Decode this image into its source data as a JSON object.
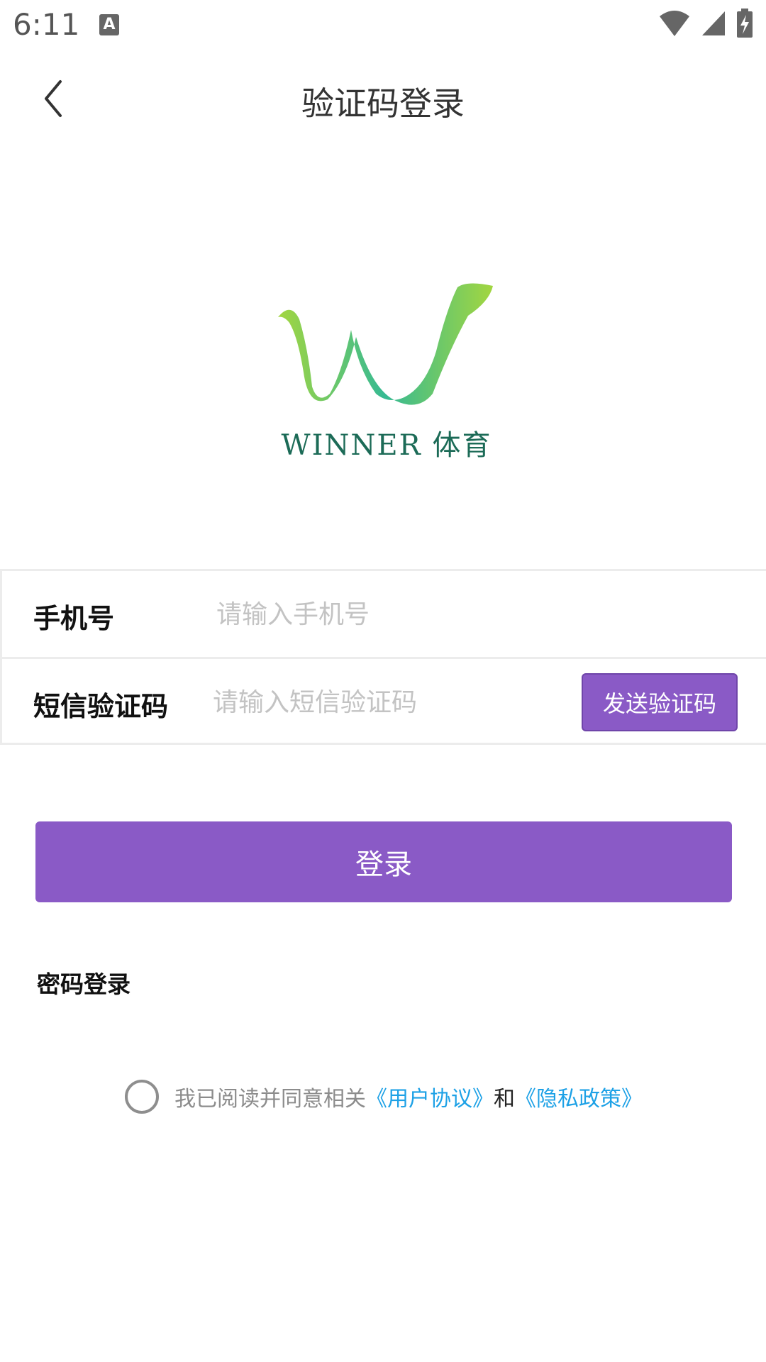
{
  "status_bar": {
    "time": "6:11",
    "notification_icon_letter": "A"
  },
  "header": {
    "title": "验证码登录"
  },
  "logo": {
    "brand_text": "WINNER 体育",
    "colors": [
      "#1c6b57",
      "#9ed436"
    ]
  },
  "form": {
    "phone": {
      "label": "手机号",
      "placeholder": "请输入手机号",
      "value": ""
    },
    "sms_code": {
      "label": "短信验证码",
      "placeholder": "请输入短信验证码",
      "value": "",
      "send_button": "发送验证码"
    }
  },
  "actions": {
    "login": "登录",
    "password_login": "密码登录"
  },
  "agreement": {
    "text": "我已阅读并同意相关",
    "user_agreement": "《用户协议》",
    "and": "和",
    "privacy_policy": "《隐私政策》",
    "checked": false
  },
  "theme": {
    "primary": "#8a5ac6",
    "link": "#1da1e6"
  }
}
